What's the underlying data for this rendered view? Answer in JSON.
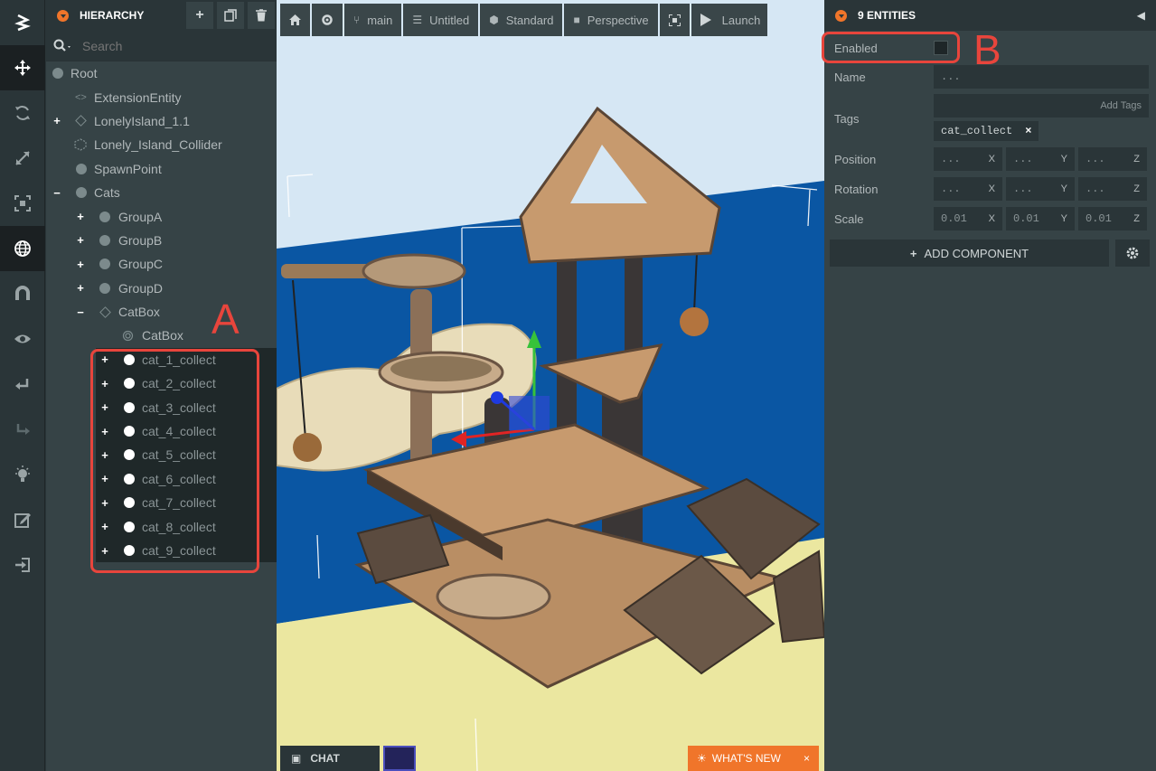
{
  "toolbar": {
    "tools": [
      {
        "icon": "logo-icon"
      },
      {
        "icon": "translate-icon"
      },
      {
        "icon": "rotate-icon"
      },
      {
        "icon": "scale-icon"
      },
      {
        "icon": "resize-icon"
      },
      {
        "icon": "world-icon"
      },
      {
        "icon": "magnet-icon"
      },
      {
        "icon": "eye-icon"
      },
      {
        "icon": "undo-icon"
      },
      {
        "icon": "redo-icon"
      },
      {
        "icon": "lightbulb-icon"
      },
      {
        "icon": "edit-icon"
      },
      {
        "icon": "publish-icon"
      }
    ]
  },
  "hierarchy": {
    "title": "HIERARCHY",
    "search_placeholder": "Search",
    "nodes": [
      {
        "label": "Root"
      },
      {
        "label": "ExtensionEntity"
      },
      {
        "label": "LonelyIsland_1.1"
      },
      {
        "label": "Lonely_Island_Collider"
      },
      {
        "label": "SpawnPoint"
      },
      {
        "label": "Cats"
      },
      {
        "label": "GroupA"
      },
      {
        "label": "GroupB"
      },
      {
        "label": "GroupC"
      },
      {
        "label": "GroupD"
      },
      {
        "label": "CatBox"
      },
      {
        "label": "CatBox"
      },
      {
        "label": "cat_1_collect"
      },
      {
        "label": "cat_2_collect"
      },
      {
        "label": "cat_3_collect"
      },
      {
        "label": "cat_4_collect"
      },
      {
        "label": "cat_5_collect"
      },
      {
        "label": "cat_6_collect"
      },
      {
        "label": "cat_7_collect"
      },
      {
        "label": "cat_8_collect"
      },
      {
        "label": "cat_9_collect"
      }
    ]
  },
  "viewport": {
    "toolbar": {
      "branch": "main",
      "scene": "Untitled",
      "render": "Standard",
      "camera": "Perspective",
      "launch": "Launch"
    },
    "chat": "CHAT",
    "whats_new": "WHAT'S NEW",
    "close": "×"
  },
  "inspector": {
    "title": "9 ENTITIES",
    "enabled_label": "Enabled",
    "name_label": "Name",
    "name_value": "...",
    "tags_label": "Tags",
    "add_tags": "Add Tags",
    "tag": "cat_collect",
    "tag_remove": "×",
    "position_label": "Position",
    "rotation_label": "Rotation",
    "scale_label": "Scale",
    "position": [
      "...",
      "...",
      "..."
    ],
    "rotation": [
      "...",
      "...",
      "..."
    ],
    "scale": [
      "0.01",
      "0.01",
      "0.01"
    ],
    "axes": [
      "X",
      "Y",
      "Z"
    ],
    "add_component": "ADD COMPONENT"
  },
  "annotations": {
    "a": "A",
    "b": "B"
  },
  "colors": {
    "accent": "#f0752a",
    "annotation": "#e8453c",
    "panel": "#364346",
    "dark": "#2a3538"
  }
}
